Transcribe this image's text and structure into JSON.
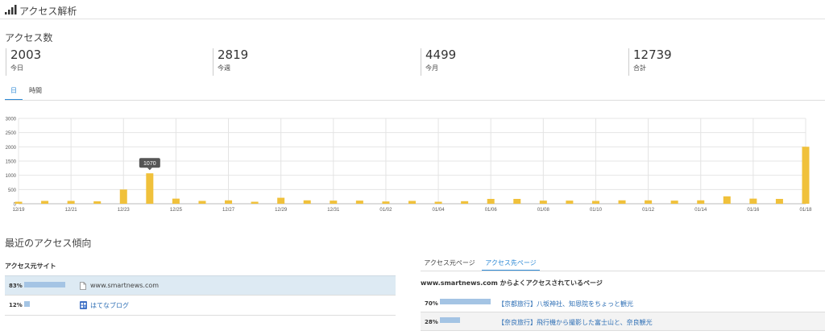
{
  "header": {
    "title": "アクセス解析",
    "icon": "signal-bars-icon"
  },
  "access_count": {
    "title": "アクセス数",
    "stats": [
      {
        "value": "2003",
        "label": "今日"
      },
      {
        "value": "2819",
        "label": "今週"
      },
      {
        "value": "4499",
        "label": "今月"
      },
      {
        "value": "12739",
        "label": "合計"
      }
    ]
  },
  "period_tabs": [
    {
      "label": "日",
      "active": true
    },
    {
      "label": "時間",
      "active": false
    }
  ],
  "chart_data": {
    "type": "bar",
    "categories": [
      "12/19",
      "12/20",
      "12/21",
      "12/22",
      "12/23",
      "12/24",
      "12/25",
      "12/26",
      "12/27",
      "12/28",
      "12/29",
      "12/30",
      "12/31",
      "01/01",
      "01/02",
      "01/03",
      "01/04",
      "01/05",
      "01/06",
      "01/07",
      "01/08",
      "01/09",
      "01/10",
      "01/11",
      "01/12",
      "01/13",
      "01/14",
      "01/15",
      "01/16",
      "01/17",
      "01/18"
    ],
    "x_tick_labels": [
      "12/19",
      "12/21",
      "12/23",
      "12/25",
      "12/27",
      "12/29",
      "12/31",
      "01/02",
      "01/04",
      "01/06",
      "01/08",
      "01/10",
      "01/12",
      "01/14",
      "01/16",
      "01/18"
    ],
    "values": [
      70,
      100,
      100,
      85,
      500,
      1070,
      180,
      100,
      120,
      70,
      210,
      120,
      110,
      110,
      80,
      100,
      70,
      90,
      170,
      170,
      110,
      110,
      100,
      120,
      120,
      110,
      120,
      260,
      180,
      170,
      2003
    ],
    "ylim": [
      0,
      3000
    ],
    "y_ticks": [
      0,
      500,
      1000,
      1500,
      2000,
      2500,
      3000
    ],
    "tooltip": {
      "category": "12/24",
      "value": "1070"
    },
    "bar_color": "#f0c13b",
    "grid": true
  },
  "trend": {
    "title": "最近のアクセス傾向",
    "sources_title": "アクセス元サイト",
    "sources": [
      {
        "pct": "83%",
        "share": 0.83,
        "name": "www.smartnews.com",
        "icon": "document-icon",
        "is_link": false
      },
      {
        "pct": "12%",
        "share": 0.12,
        "name": "はてなブログ",
        "icon": "hatena-blog-icon",
        "is_link": true
      }
    ],
    "page_tabs": [
      {
        "label": "アクセス元ページ",
        "active": false
      },
      {
        "label": "アクセス先ページ",
        "active": true
      }
    ],
    "dest_title": "www.smartnews.com からよくアクセスされているページ",
    "destinations": [
      {
        "pct": "70%",
        "share": 0.7,
        "title": "【京都旅行】八坂神社、知恩院をちょっと観光"
      },
      {
        "pct": "28%",
        "share": 0.28,
        "title": "【奈良旅行】飛行機から撮影した富士山と、奈良観光"
      }
    ]
  }
}
